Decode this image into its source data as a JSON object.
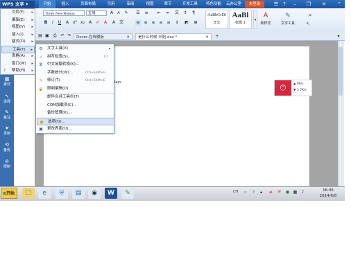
{
  "app": {
    "name": "WPS 文字",
    "login": "未登录"
  },
  "ribbon_tabs": [
    "开始",
    "插入",
    "页面布局",
    "引用",
    "审阅",
    "视图",
    "章节",
    "开发工具",
    "特色功能",
    "云办公室"
  ],
  "ribbon": {
    "font_name": "Times New Roman",
    "font_size": "五号",
    "styles": [
      {
        "sample": "AaBbCcDi",
        "label": "正文"
      },
      {
        "sample": "AaBl",
        "label": "标题 1"
      }
    ],
    "new_style": "新样式",
    "text_tools": "文字工具"
  },
  "doc_tabs": [
    "Docer-在线模板",
    "是什么时候 开始.doc *"
  ],
  "left_panel": [
    "素材",
    "选择",
    "备注",
    "发射",
    "备份",
    "限制"
  ],
  "menu": [
    {
      "label": "文件(F)"
    },
    {
      "label": "编辑(E)"
    },
    {
      "label": "视图(V)"
    },
    {
      "label": "插入(I)"
    },
    {
      "label": "格式(O)"
    },
    {
      "label": "工具(T)"
    },
    {
      "label": "表格(A)"
    },
    {
      "label": "窗口(W)"
    },
    {
      "label": "帮助(H)"
    }
  ],
  "submenu": [
    {
      "label": "文字工具(X)",
      "shortcut": "",
      "icon": "text-tools-icon",
      "glyph": "⚙"
    },
    {
      "label": "拼写检查(S)...",
      "shortcut": "F7",
      "icon": "spellcheck-icon",
      "glyph": "✓"
    },
    {
      "label": "中文简繁转换(K)...",
      "shortcut": "",
      "icon": "convert-icon",
      "glyph": "繁"
    },
    {
      "label": "字数统计(W)...",
      "shortcut": "Ctrl+Shift+G",
      "icon": "",
      "glyph": ""
    },
    {
      "label": "修订(T)",
      "shortcut": "Ctrl+Shift+E",
      "icon": "revise-icon",
      "glyph": "✎"
    },
    {
      "label": "限制编辑(D)",
      "shortcut": "",
      "icon": "restrict-icon",
      "glyph": "🔒"
    },
    {
      "label": "邮件合并工具栏(T)",
      "shortcut": "",
      "icon": "",
      "glyph": ""
    },
    {
      "label": "COM加载项(C)...",
      "shortcut": "",
      "icon": "",
      "glyph": ""
    },
    {
      "label": "备份管理(K)...",
      "shortcut": "",
      "icon": "",
      "glyph": ""
    },
    {
      "label": "选项(O)...",
      "shortcut": "",
      "icon": "options-icon",
      "glyph": "●"
    },
    {
      "label": "更改界面(U)...",
      "shortcut": "",
      "icon": "change-ui-icon",
      "glyph": "▣"
    }
  ],
  "document": {
    "visible_text": "lays"
  },
  "net_widget": {
    "up": "0K/s",
    "down": "3.7K/s"
  },
  "taskbar": {
    "start": "开始",
    "tray": [
      "CH"
    ],
    "time": "16:36",
    "date": "2014/6/8"
  }
}
